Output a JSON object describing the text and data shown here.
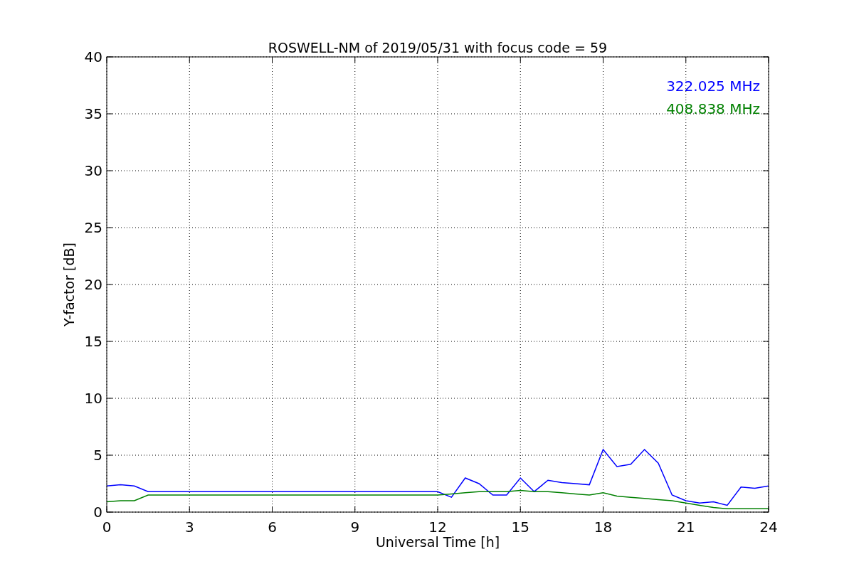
{
  "chart_data": {
    "type": "line",
    "title": "ROSWELL-NM of 2019/05/31 with focus code = 59",
    "xlabel": "Universal Time [h]",
    "ylabel": "Y-factor [dB]",
    "x": [
      0,
      0.5,
      1,
      1.5,
      2,
      2.5,
      3,
      3.5,
      4,
      4.5,
      5,
      5.5,
      6,
      6.5,
      7,
      7.5,
      8,
      8.5,
      9,
      9.5,
      10,
      10.5,
      11,
      11.5,
      12,
      12.5,
      13,
      13.5,
      14,
      14.5,
      15,
      15.5,
      16,
      16.5,
      17,
      17.5,
      18,
      18.5,
      19,
      19.5,
      20,
      20.5,
      21,
      21.5,
      22,
      22.5,
      23,
      23.5,
      24
    ],
    "series": [
      {
        "name": "322.025 MHz",
        "color": "#0000ff",
        "values": [
          2.3,
          2.4,
          2.3,
          1.8,
          1.8,
          1.8,
          1.8,
          1.8,
          1.8,
          1.8,
          1.8,
          1.8,
          1.8,
          1.8,
          1.8,
          1.8,
          1.8,
          1.8,
          1.8,
          1.8,
          1.8,
          1.8,
          1.8,
          1.8,
          1.8,
          1.3,
          3.0,
          2.5,
          1.5,
          1.5,
          3.0,
          1.8,
          2.8,
          2.6,
          2.5,
          2.4,
          5.5,
          4.0,
          4.2,
          5.5,
          4.3,
          1.5,
          1.0,
          0.8,
          0.9,
          0.6,
          2.2,
          2.1,
          2.3
        ]
      },
      {
        "name": "408.838 MHz",
        "color": "#008000",
        "values": [
          0.9,
          1.0,
          1.0,
          1.5,
          1.5,
          1.5,
          1.5,
          1.5,
          1.5,
          1.5,
          1.5,
          1.5,
          1.5,
          1.5,
          1.5,
          1.5,
          1.5,
          1.5,
          1.5,
          1.5,
          1.5,
          1.5,
          1.5,
          1.5,
          1.5,
          1.6,
          1.7,
          1.8,
          1.8,
          1.8,
          1.9,
          1.8,
          1.8,
          1.7,
          1.6,
          1.5,
          1.7,
          1.4,
          1.3,
          1.2,
          1.1,
          1.0,
          0.8,
          0.6,
          0.4,
          0.3,
          0.3,
          0.3,
          0.3
        ]
      }
    ],
    "grid": true,
    "xlim": [
      0,
      24
    ],
    "ylim": [
      0,
      40
    ],
    "xticks": [
      0,
      3,
      6,
      9,
      12,
      15,
      18,
      21,
      24
    ],
    "yticks": [
      0,
      5,
      10,
      15,
      20,
      25,
      30,
      35,
      40
    ]
  }
}
